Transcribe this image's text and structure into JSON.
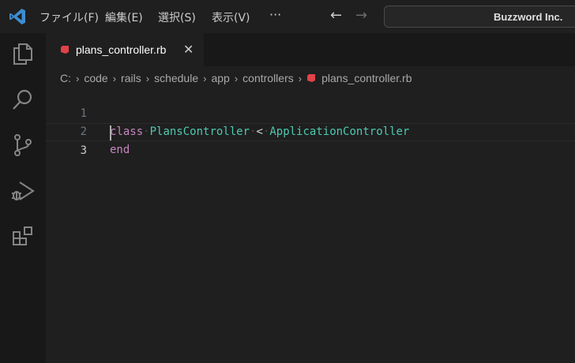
{
  "menu": {
    "file": "ファイル(F)",
    "edit": "編集(E)",
    "selection": "選択(S)",
    "view": "表示(V)",
    "more": "···"
  },
  "nav": {
    "back": "←",
    "forward": "→"
  },
  "search": {
    "text": "Buzzword Inc."
  },
  "activity_bar": {
    "items": [
      "explorer-icon",
      "search-icon",
      "source-control-icon",
      "run-debug-icon",
      "extensions-icon"
    ]
  },
  "tab": {
    "label": "plans_controller.rb",
    "close": "✕",
    "icon": "ruby-icon"
  },
  "breadcrumb": {
    "segments": [
      "C:",
      "code",
      "rails",
      "schedule",
      "app",
      "controllers",
      "plans_controller.rb"
    ],
    "separator": "›"
  },
  "editor": {
    "lines": [
      {
        "number": "1",
        "tokens": {
          "kw": "class",
          "cls": "PlansController",
          "op": "<",
          "parent": "ApplicationController"
        }
      },
      {
        "number": "2",
        "tokens": {
          "kw": "end"
        }
      },
      {
        "number": "3",
        "tokens": {}
      }
    ],
    "current_line": 3
  },
  "colors": {
    "background": "#1f1f1f",
    "keyword": "#c586c0",
    "class_name": "#4ec9b0",
    "ruby_red": "#e0424a",
    "vscode_blue": "#3e8ed0"
  }
}
